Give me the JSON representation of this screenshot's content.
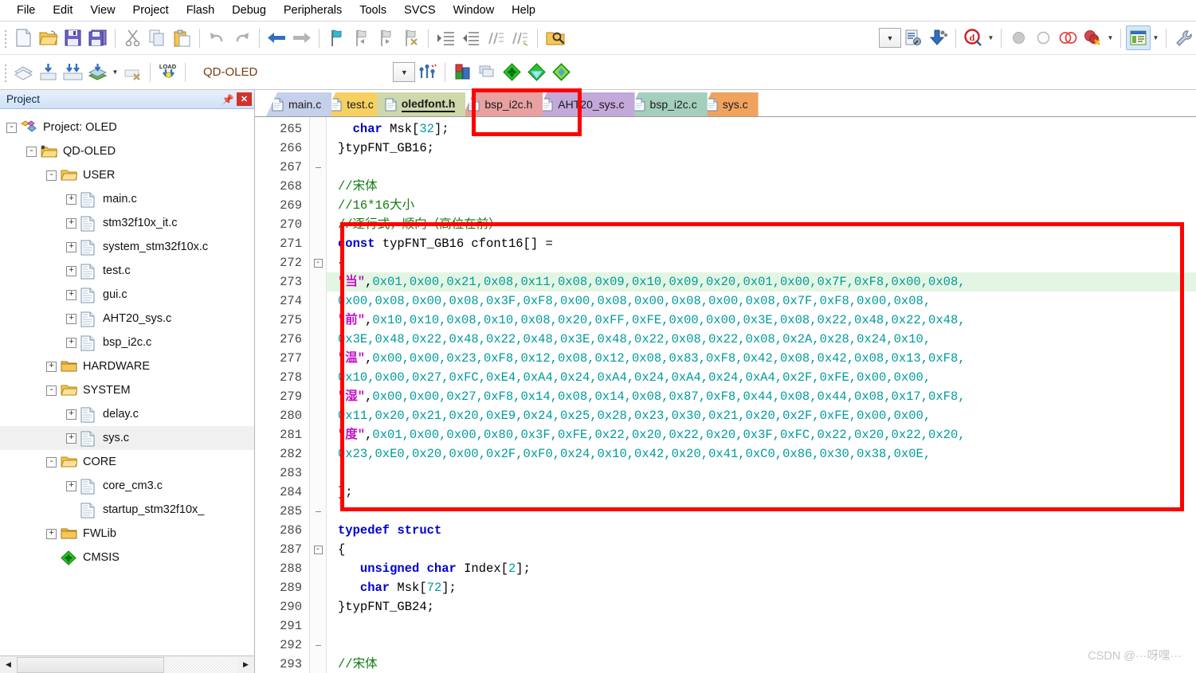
{
  "menu": {
    "items": [
      {
        "label": "File"
      },
      {
        "label": "Edit"
      },
      {
        "label": "View"
      },
      {
        "label": "Project"
      },
      {
        "label": "Flash"
      },
      {
        "label": "Debug"
      },
      {
        "label": "Peripherals"
      },
      {
        "label": "Tools"
      },
      {
        "label": "SVCS"
      },
      {
        "label": "Window"
      },
      {
        "label": "Help"
      }
    ]
  },
  "toolbar1": {
    "buttons": [
      {
        "icon": "new-file-icon",
        "label": "New"
      },
      {
        "icon": "open-folder-icon",
        "label": "Open"
      },
      {
        "icon": "save-icon",
        "label": "Save"
      },
      {
        "icon": "save-all-icon",
        "label": "Save All"
      },
      {
        "icon": "cut-icon",
        "label": "Cut"
      },
      {
        "icon": "copy-icon",
        "label": "Copy"
      },
      {
        "icon": "paste-icon",
        "label": "Paste"
      },
      {
        "icon": "undo-icon",
        "label": "Undo"
      },
      {
        "icon": "redo-icon",
        "label": "Redo"
      },
      {
        "icon": "navigate-back-icon",
        "label": "Back"
      },
      {
        "icon": "navigate-forward-icon",
        "label": "Forward"
      },
      {
        "icon": "bookmark-toggle-icon",
        "label": "Insert/Remove Bookmark"
      },
      {
        "icon": "bookmark-prev-icon",
        "label": "Previous Bookmark"
      },
      {
        "icon": "bookmark-next-icon",
        "label": "Next Bookmark"
      },
      {
        "icon": "bookmark-clear-icon",
        "label": "Clear All Bookmarks"
      },
      {
        "icon": "indent-right-icon",
        "label": "Indent"
      },
      {
        "icon": "indent-left-icon",
        "label": "Unindent"
      },
      {
        "icon": "comment-icon",
        "label": "Comment Selection"
      },
      {
        "icon": "uncomment-icon",
        "label": "Uncomment Selection"
      },
      {
        "icon": "find-in-files-icon",
        "label": "Find in Files"
      }
    ],
    "right_buttons": [
      {
        "icon": "combo-chevron-icon",
        "label": "Options List"
      },
      {
        "icon": "configure-target-icon",
        "label": "Configure Target"
      },
      {
        "icon": "manage-components-icon",
        "label": "Manage Components"
      },
      {
        "icon": "start-debug-icon",
        "label": "Start/Stop Debug Session"
      },
      {
        "icon": "insert-breakpoint-icon",
        "label": "Insert/Remove Breakpoint"
      },
      {
        "icon": "disable-breakpoint-icon",
        "label": "Enable/Disable Breakpoint"
      },
      {
        "icon": "disable-all-breakpoints-icon",
        "label": "Disable All Breakpoints"
      },
      {
        "icon": "kill-all-breakpoints-icon",
        "label": "Kill All Breakpoints"
      },
      {
        "icon": "project-window-icon",
        "label": "Project Window"
      },
      {
        "icon": "wrench-icon",
        "label": "Configuration Wizard"
      }
    ]
  },
  "toolbar2": {
    "buttons": [
      {
        "icon": "translate-icon",
        "label": "Translate"
      },
      {
        "icon": "build-icon",
        "label": "Build"
      },
      {
        "icon": "rebuild-icon",
        "label": "Rebuild"
      },
      {
        "icon": "batch-build-icon",
        "label": "Batch Build"
      },
      {
        "icon": "stop-build-icon",
        "label": "Stop Build"
      },
      {
        "icon": "load-icon",
        "label": "Download"
      }
    ],
    "target_name": "QD-OLED",
    "after_buttons": [
      {
        "icon": "combo-chevron-icon",
        "label": "Select Target"
      },
      {
        "icon": "target-options-icon",
        "label": "Target Options"
      },
      {
        "icon": "manage-project-items-icon",
        "label": "Manage Project Items"
      },
      {
        "icon": "multi-project-icon",
        "label": "Multi-Project"
      },
      {
        "icon": "pack-installer-green-icon",
        "label": "Pack Installer"
      },
      {
        "icon": "pack-installer-cyan-icon",
        "label": "Packs"
      },
      {
        "icon": "pack-installer-multi-icon",
        "label": "Run Utility"
      }
    ]
  },
  "project_panel": {
    "title": "Project",
    "pin_icon": "pin-icon",
    "close_icon": "close-icon",
    "tree": [
      {
        "label": "Project: OLED",
        "depth": 0,
        "expander": "-",
        "icon": "project-icon",
        "selected": false
      },
      {
        "label": "QD-OLED",
        "depth": 1,
        "expander": "-",
        "icon": "target-icon",
        "selected": false
      },
      {
        "label": "USER",
        "depth": 2,
        "expander": "-",
        "icon": "folder-open-icon",
        "selected": false
      },
      {
        "label": "main.c",
        "depth": 3,
        "expander": "+",
        "icon": "c-file-icon",
        "selected": false
      },
      {
        "label": "stm32f10x_it.c",
        "depth": 3,
        "expander": "+",
        "icon": "c-file-icon",
        "selected": false
      },
      {
        "label": "system_stm32f10x.c",
        "depth": 3,
        "expander": "+",
        "icon": "c-file-icon",
        "selected": false
      },
      {
        "label": "test.c",
        "depth": 3,
        "expander": "+",
        "icon": "c-file-icon",
        "selected": false
      },
      {
        "label": "gui.c",
        "depth": 3,
        "expander": "+",
        "icon": "c-file-icon",
        "selected": false
      },
      {
        "label": "AHT20_sys.c",
        "depth": 3,
        "expander": "+",
        "icon": "c-file-icon",
        "selected": false
      },
      {
        "label": "bsp_i2c.c",
        "depth": 3,
        "expander": "+",
        "icon": "c-file-icon",
        "selected": false
      },
      {
        "label": "HARDWARE",
        "depth": 2,
        "expander": "+",
        "icon": "folder-closed-icon",
        "selected": false
      },
      {
        "label": "SYSTEM",
        "depth": 2,
        "expander": "-",
        "icon": "folder-open-icon",
        "selected": false
      },
      {
        "label": "delay.c",
        "depth": 3,
        "expander": "+",
        "icon": "c-file-icon",
        "selected": false
      },
      {
        "label": "sys.c",
        "depth": 3,
        "expander": "+",
        "icon": "c-file-icon",
        "selected": true
      },
      {
        "label": "CORE",
        "depth": 2,
        "expander": "-",
        "icon": "folder-open-icon",
        "selected": false
      },
      {
        "label": "core_cm3.c",
        "depth": 3,
        "expander": "+",
        "icon": "c-file-icon",
        "selected": false
      },
      {
        "label": "startup_stm32f10x_",
        "depth": 3,
        "expander": "",
        "icon": "c-file-icon",
        "selected": false
      },
      {
        "label": "FWLib",
        "depth": 2,
        "expander": "+",
        "icon": "folder-closed-icon",
        "selected": false
      },
      {
        "label": "CMSIS",
        "depth": 2,
        "expander": "",
        "icon": "cmsis-icon",
        "selected": false
      }
    ],
    "hscroll": {
      "left_arrow": "◀",
      "right_arrow": "▶"
    }
  },
  "editor": {
    "tabs": [
      {
        "label": "main.c",
        "color": "#c5d0ea",
        "active": false
      },
      {
        "label": "test.c",
        "color": "#f6d161",
        "active": false
      },
      {
        "label": "oledfont.h",
        "color": "#cdd8ab",
        "active": true
      },
      {
        "label": "bsp_i2c.h",
        "color": "#e8a0a0",
        "active": false
      },
      {
        "label": "AHT20_sys.c",
        "color": "#c3a8da",
        "active": false
      },
      {
        "label": "bsp_i2c.c",
        "color": "#a5cfbd",
        "active": false
      },
      {
        "label": "sys.c",
        "color": "#f0a35f",
        "active": false
      }
    ],
    "first_line": 265,
    "current_line": 273,
    "lines": [
      {
        "n": 265,
        "fold": "",
        "tokens": [
          {
            "t": "  ",
            "c": "punc"
          },
          {
            "t": "char",
            "c": "key"
          },
          {
            "t": " Msk[",
            "c": "punc"
          },
          {
            "t": "32",
            "c": "num"
          },
          {
            "t": "];",
            "c": "punc"
          }
        ]
      },
      {
        "n": 266,
        "fold": "",
        "tokens": [
          {
            "t": "}typFNT_GB16;",
            "c": "punc"
          }
        ]
      },
      {
        "n": 267,
        "fold": "tick",
        "tokens": []
      },
      {
        "n": 268,
        "fold": "",
        "tokens": [
          {
            "t": "//宋体",
            "c": "cmt"
          }
        ]
      },
      {
        "n": 269,
        "fold": "",
        "tokens": [
          {
            "t": "//16*16大小",
            "c": "cmt"
          }
        ]
      },
      {
        "n": 270,
        "fold": "",
        "tokens": [
          {
            "t": "//逐行式，顺向（高位在前）",
            "c": "cmt"
          }
        ]
      },
      {
        "n": 271,
        "fold": "",
        "tokens": [
          {
            "t": "const",
            "c": "key"
          },
          {
            "t": " typFNT_GB16 cfont16[] =",
            "c": "punc"
          }
        ]
      },
      {
        "n": 272,
        "fold": "minus",
        "tokens": [
          {
            "t": "{",
            "c": "punc"
          }
        ]
      },
      {
        "n": 273,
        "fold": "",
        "tokens": [
          {
            "t": "\"当\"",
            "c": "str"
          },
          {
            "t": ",",
            "c": "punc"
          },
          {
            "t": "0x01,0x00,0x21,0x08,0x11,0x08,0x09,0x10,0x09,0x20,0x01,0x00,0x7F,0xF8,0x00,0x08,",
            "c": "hex"
          }
        ]
      },
      {
        "n": 274,
        "fold": "",
        "tokens": [
          {
            "t": "0x00,0x08,0x00,0x08,0x3F,0xF8,0x00,0x08,0x00,0x08,0x00,0x08,0x7F,0xF8,0x00,0x08,",
            "c": "hex"
          }
        ]
      },
      {
        "n": 275,
        "fold": "",
        "tokens": [
          {
            "t": "\"前\"",
            "c": "str"
          },
          {
            "t": ",",
            "c": "punc"
          },
          {
            "t": "0x10,0x10,0x08,0x10,0x08,0x20,0xFF,0xFE,0x00,0x00,0x3E,0x08,0x22,0x48,0x22,0x48,",
            "c": "hex"
          }
        ]
      },
      {
        "n": 276,
        "fold": "",
        "tokens": [
          {
            "t": "0x3E,0x48,0x22,0x48,0x22,0x48,0x3E,0x48,0x22,0x08,0x22,0x08,0x2A,0x28,0x24,0x10,",
            "c": "hex"
          }
        ]
      },
      {
        "n": 277,
        "fold": "",
        "tokens": [
          {
            "t": "\"温\"",
            "c": "str"
          },
          {
            "t": ",",
            "c": "punc"
          },
          {
            "t": "0x00,0x00,0x23,0xF8,0x12,0x08,0x12,0x08,0x83,0xF8,0x42,0x08,0x42,0x08,0x13,0xF8,",
            "c": "hex"
          }
        ]
      },
      {
        "n": 278,
        "fold": "",
        "tokens": [
          {
            "t": "0x10,0x00,0x27,0xFC,0xE4,0xA4,0x24,0xA4,0x24,0xA4,0x24,0xA4,0x2F,0xFE,0x00,0x00,",
            "c": "hex"
          }
        ]
      },
      {
        "n": 279,
        "fold": "",
        "tokens": [
          {
            "t": "\"湿\"",
            "c": "str"
          },
          {
            "t": ",",
            "c": "punc"
          },
          {
            "t": "0x00,0x00,0x27,0xF8,0x14,0x08,0x14,0x08,0x87,0xF8,0x44,0x08,0x44,0x08,0x17,0xF8,",
            "c": "hex"
          }
        ]
      },
      {
        "n": 280,
        "fold": "",
        "tokens": [
          {
            "t": "0x11,0x20,0x21,0x20,0xE9,0x24,0x25,0x28,0x23,0x30,0x21,0x20,0x2F,0xFE,0x00,0x00,",
            "c": "hex"
          }
        ]
      },
      {
        "n": 281,
        "fold": "",
        "tokens": [
          {
            "t": "\"度\"",
            "c": "str"
          },
          {
            "t": ",",
            "c": "punc"
          },
          {
            "t": "0x01,0x00,0x00,0x80,0x3F,0xFE,0x22,0x20,0x22,0x20,0x3F,0xFC,0x22,0x20,0x22,0x20,",
            "c": "hex"
          }
        ]
      },
      {
        "n": 282,
        "fold": "",
        "tokens": [
          {
            "t": "0x23,0xE0,0x20,0x00,0x2F,0xF0,0x24,0x10,0x42,0x20,0x41,0xC0,0x86,0x30,0x38,0x0E,",
            "c": "hex"
          }
        ]
      },
      {
        "n": 283,
        "fold": "",
        "tokens": []
      },
      {
        "n": 284,
        "fold": "",
        "tokens": [
          {
            "t": "};",
            "c": "punc"
          }
        ]
      },
      {
        "n": 285,
        "fold": "tick",
        "tokens": []
      },
      {
        "n": 286,
        "fold": "",
        "tokens": [
          {
            "t": "typedef",
            "c": "key"
          },
          {
            "t": " ",
            "c": "punc"
          },
          {
            "t": "struct",
            "c": "key"
          }
        ]
      },
      {
        "n": 287,
        "fold": "minus",
        "tokens": [
          {
            "t": "{",
            "c": "punc"
          }
        ]
      },
      {
        "n": 288,
        "fold": "",
        "tokens": [
          {
            "t": "   ",
            "c": "punc"
          },
          {
            "t": "unsigned char",
            "c": "key"
          },
          {
            "t": " Index[",
            "c": "punc"
          },
          {
            "t": "2",
            "c": "num"
          },
          {
            "t": "];",
            "c": "punc"
          }
        ]
      },
      {
        "n": 289,
        "fold": "",
        "tokens": [
          {
            "t": "   ",
            "c": "punc"
          },
          {
            "t": "char",
            "c": "key"
          },
          {
            "t": " Msk[",
            "c": "punc"
          },
          {
            "t": "72",
            "c": "num"
          },
          {
            "t": "];",
            "c": "punc"
          }
        ]
      },
      {
        "n": 290,
        "fold": "",
        "tokens": [
          {
            "t": "}typFNT_GB24;",
            "c": "punc"
          }
        ]
      },
      {
        "n": 291,
        "fold": "",
        "tokens": []
      },
      {
        "n": 292,
        "fold": "tick",
        "tokens": []
      },
      {
        "n": 293,
        "fold": "",
        "tokens": [
          {
            "t": "//宋体",
            "c": "cmt"
          }
        ]
      }
    ]
  },
  "annotations": [
    {
      "name": "annot-tab",
      "target": "oledfont.h tab",
      "color": "#ff0000"
    },
    {
      "name": "annot-code",
      "target": "cfont16 array",
      "color": "#ff0000"
    }
  ],
  "watermark": {
    "text": "CSDN @···呀嘿···"
  }
}
